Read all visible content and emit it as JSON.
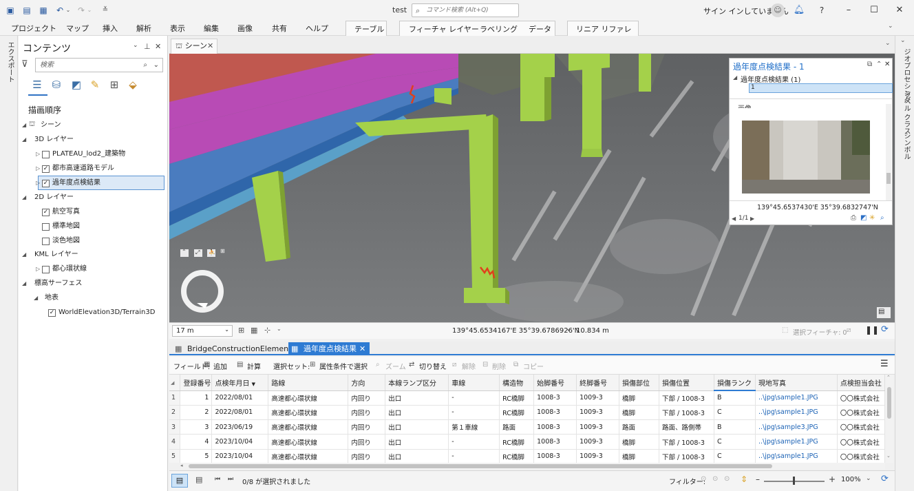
{
  "titlebar": {
    "title": "test",
    "command_search_placeholder": "コマンド検索 (Alt+Q)",
    "signin": "サイン インしていません"
  },
  "ribbon": {
    "tabs": [
      "プロジェクト",
      "マップ",
      "挿入",
      "解析",
      "表示",
      "編集",
      "画像",
      "共有",
      "ヘルプ"
    ],
    "table_tab": "テーブル",
    "feature_layer_tabs": [
      "フィーチャ レイヤー",
      "ラベリング",
      "データ"
    ],
    "linear_ref_tab": "リニア リファレンス"
  },
  "left_strip": {
    "label": "エクスポート"
  },
  "contents": {
    "title": "コンテンツ",
    "search_placeholder": "検索",
    "draw_order": "描画順序",
    "tree": [
      {
        "label": "シーン",
        "level": 0,
        "expanded": true,
        "icon": "scene-icon"
      },
      {
        "label": "3D レイヤー",
        "level": 1,
        "expanded": true
      },
      {
        "label": "PLATEAU_lod2_建築物",
        "level": 2,
        "checked": false,
        "collapsed": true
      },
      {
        "label": "都市高速道路モデル",
        "level": 2,
        "checked": true,
        "collapsed": true
      },
      {
        "label": "過年度点検結果",
        "level": 2,
        "checked": true,
        "collapsed": true,
        "selected": true
      },
      {
        "label": "2D レイヤー",
        "level": 1,
        "expanded": true
      },
      {
        "label": "航空写真",
        "level": 2,
        "checked": true
      },
      {
        "label": "標準地図",
        "level": 2,
        "checked": false
      },
      {
        "label": "淡色地図",
        "level": 2,
        "checked": false
      },
      {
        "label": "KML レイヤー",
        "level": 1,
        "expanded": true
      },
      {
        "label": "都心環状線",
        "level": 2,
        "checked": false,
        "collapsed": true
      },
      {
        "label": "標高サーフェス",
        "level": 1,
        "expanded": true
      },
      {
        "label": "地表",
        "level": 2,
        "expanded": true
      },
      {
        "label": "WorldElevation3D/Terrain3D",
        "level": 3,
        "checked": true
      }
    ]
  },
  "scene": {
    "tab_label": "シーン",
    "scale": "17 m",
    "coords": "139°45.6534167'E 35°39.6786926'N",
    "elevation": "10.834 m",
    "selected_features": "選択フィーチャ: 0"
  },
  "popup": {
    "title": "過年度点検結果 - 1",
    "layer_entry": "過年度点検結果 (1)",
    "feature_entry": "1",
    "section_label": "画像",
    "coords": "139°45.6537430'E 35°39.6832747'N",
    "page": "1/1"
  },
  "right_strip": {
    "labels": [
      "ジオプロセシング",
      "ラベル クラス",
      "シンボル"
    ]
  },
  "table_tabs": [
    {
      "label": "BridgeConstructionElement",
      "active": false
    },
    {
      "label": "過年度点検結果",
      "active": true
    }
  ],
  "table_toolbar": {
    "field_label": "フィールド:",
    "add": "追加",
    "calc": "計算",
    "selection_set": "選択セット:",
    "select_by_attr": "属性条件で選択",
    "zoom": "ズーム",
    "switch": "切り替え",
    "clear": "解除",
    "delete": "削除",
    "copy": "コピー"
  },
  "table": {
    "columns": [
      "登録番号",
      "点検年月日",
      "路線",
      "方向",
      "本線ランプ区分",
      "車線",
      "構造物",
      "始脚番号",
      "終脚番号",
      "損傷部位",
      "損傷位置",
      "損傷ランク",
      "現地写真",
      "点検担当会社"
    ],
    "rows": [
      [
        "1",
        "2022/08/01",
        "高速都心環状線",
        "内回り",
        "出口",
        "-",
        "RC橋脚",
        "1008-3",
        "1009-3",
        "橋脚",
        "下部 / 1008-3",
        "B",
        "..\\jpg\\sample1.JPG",
        "〇〇株式会社"
      ],
      [
        "2",
        "2022/08/01",
        "高速都心環状線",
        "内回り",
        "出口",
        "-",
        "RC橋脚",
        "1008-3",
        "1009-3",
        "橋脚",
        "下部 / 1008-3",
        "C",
        "..\\jpg\\sample1.JPG",
        "〇〇株式会社"
      ],
      [
        "3",
        "2023/06/19",
        "高速都心環状線",
        "内回り",
        "出口",
        "第１車線",
        "路面",
        "1008-3",
        "1009-3",
        "路面",
        "路面、路側帯",
        "B",
        "..\\jpg\\sample3.JPG",
        "〇〇株式会社"
      ],
      [
        "4",
        "2023/10/04",
        "高速都心環状線",
        "内回り",
        "出口",
        "-",
        "RC橋脚",
        "1008-3",
        "1009-3",
        "橋脚",
        "下部 / 1008-3",
        "C",
        "..\\jpg\\sample1.JPG",
        "〇〇株式会社"
      ],
      [
        "5",
        "2023/10/04",
        "高速都心環状線",
        "内回り",
        "出口",
        "-",
        "RC橋脚",
        "1008-3",
        "1009-3",
        "橋脚",
        "下部 / 1008-3",
        "C",
        "..\\jpg\\sample1.JPG",
        "〇〇株式会社"
      ]
    ]
  },
  "table_status": {
    "selection": "0/8 が選択されました",
    "filter_label": "フィルター:",
    "zoom": "100%"
  },
  "colors": {
    "accent": "#2e7bd3",
    "pier": "#a4d14a",
    "deck_magenta": "#b84bb5",
    "deck_red": "#c0584f",
    "deck_blue": "#4a7cbf",
    "damage": "#e0401c"
  }
}
